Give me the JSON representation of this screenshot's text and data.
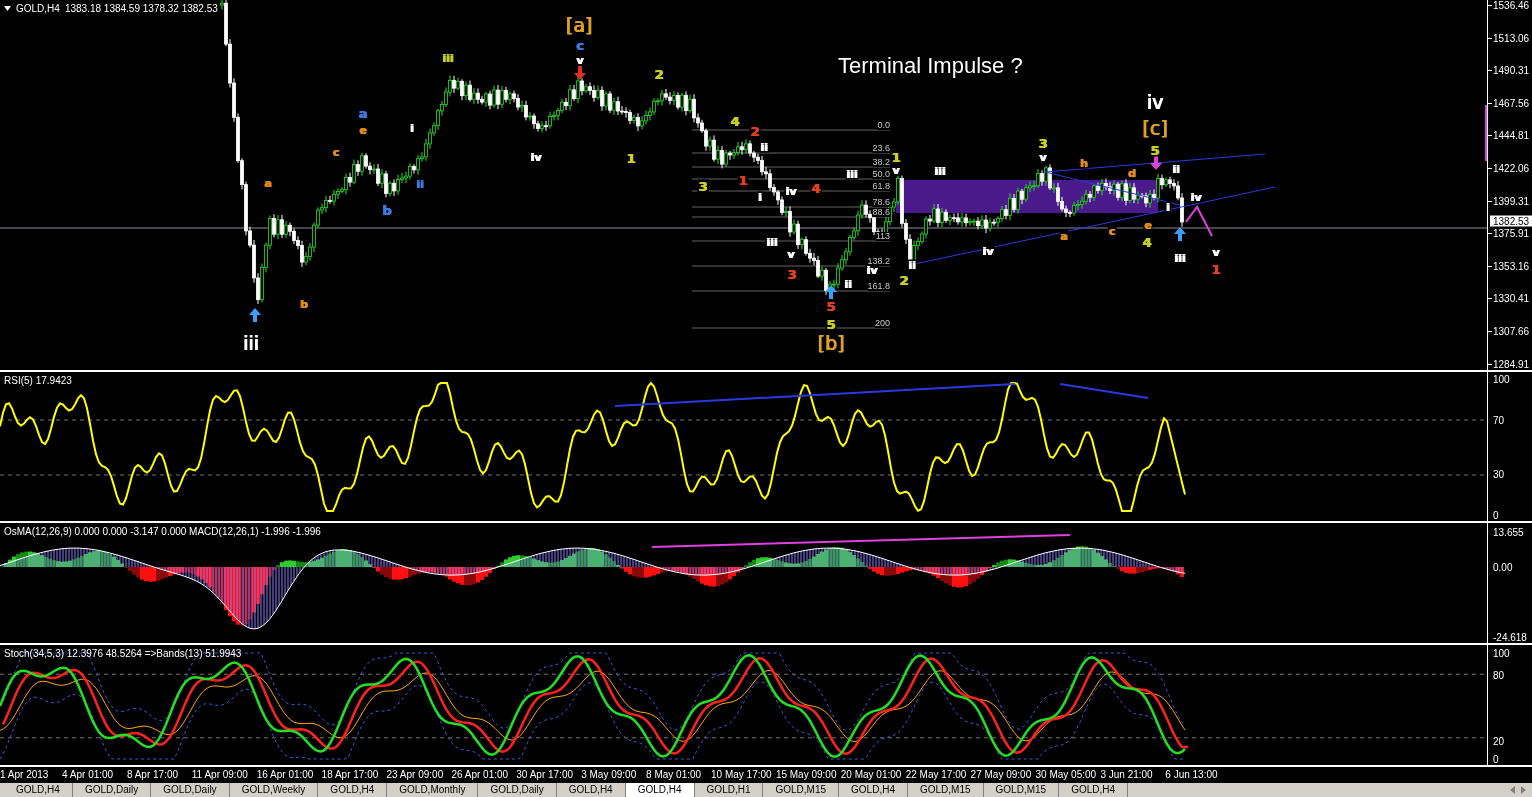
{
  "chart": {
    "symbol": "GOLD,H4",
    "ohlc": "1383.18 1384.59 1378.32 1382.53",
    "annotation": "Terminal Impulse ?",
    "price_axis": [
      "1536.46",
      "1513.06",
      "1490.31",
      "1467.56",
      "1444.81",
      "1422.06",
      "1399.31",
      "1375.91",
      "1353.16",
      "1330.41",
      "1307.66",
      "1284.91"
    ],
    "current_price": "1382.53",
    "fib_levels": [
      "0.0",
      "23.6",
      "38.2",
      "50.0",
      "61.8",
      "78.6",
      "88.6",
      "113",
      "138.2",
      "161.8",
      "200"
    ],
    "wave_labels": [
      {
        "text": "iii",
        "color": "#ffffff",
        "kind": "major"
      },
      {
        "text": "a",
        "color": "#e08a20",
        "kind": "small"
      },
      {
        "text": "b",
        "color": "#e08a20",
        "kind": "small"
      },
      {
        "text": "c",
        "color": "#e08a20",
        "kind": "small"
      },
      {
        "text": "a",
        "color": "#3a7be0",
        "kind": "minor"
      },
      {
        "text": "e",
        "color": "#e08a20",
        "kind": "small"
      },
      {
        "text": "b",
        "color": "#3a7be0",
        "kind": "minor"
      },
      {
        "text": "i",
        "color": "#ffffff",
        "kind": "small"
      },
      {
        "text": "ii",
        "color": "#3a7be0",
        "kind": "small"
      },
      {
        "text": "iii",
        "color": "#c8d020",
        "kind": "small"
      },
      {
        "text": "iv",
        "color": "#ffffff",
        "kind": "small"
      },
      {
        "text": "[a]",
        "color": "#e0a020",
        "kind": "major"
      },
      {
        "text": "c",
        "color": "#3a7be0",
        "kind": "minor"
      },
      {
        "text": "v",
        "color": "#ffffff",
        "kind": "small"
      },
      {
        "text": "1",
        "color": "#c8d020",
        "kind": "minor"
      },
      {
        "text": "2",
        "color": "#c8d020",
        "kind": "minor"
      },
      {
        "text": "3",
        "color": "#c8d020",
        "kind": "minor"
      },
      {
        "text": "4",
        "color": "#c8d020",
        "kind": "minor"
      },
      {
        "text": "1",
        "color": "#e04020",
        "kind": "minor"
      },
      {
        "text": "2",
        "color": "#e04020",
        "kind": "minor"
      },
      {
        "text": "i",
        "color": "#ffffff",
        "kind": "small"
      },
      {
        "text": "ii",
        "color": "#ffffff",
        "kind": "small"
      },
      {
        "text": "iii",
        "color": "#ffffff",
        "kind": "small"
      },
      {
        "text": "iv",
        "color": "#ffffff",
        "kind": "small"
      },
      {
        "text": "v",
        "color": "#ffffff",
        "kind": "small"
      },
      {
        "text": "3",
        "color": "#e04020",
        "kind": "minor"
      },
      {
        "text": "4",
        "color": "#e04020",
        "kind": "minor"
      },
      {
        "text": "5",
        "color": "#e04020",
        "kind": "minor"
      },
      {
        "text": "5",
        "color": "#c8d020",
        "kind": "minor"
      },
      {
        "text": "[b]",
        "color": "#e0a020",
        "kind": "major"
      },
      {
        "text": "ii",
        "color": "#ffffff",
        "kind": "small"
      },
      {
        "text": "iii",
        "color": "#ffffff",
        "kind": "small"
      },
      {
        "text": "iv",
        "color": "#ffffff",
        "kind": "small"
      },
      {
        "text": "1",
        "color": "#c8d020",
        "kind": "minor"
      },
      {
        "text": "v",
        "color": "#ffffff",
        "kind": "small"
      },
      {
        "text": "2",
        "color": "#c8d020",
        "kind": "minor"
      },
      {
        "text": "ii",
        "color": "#ffffff",
        "kind": "small"
      },
      {
        "text": "iii",
        "color": "#ffffff",
        "kind": "small"
      },
      {
        "text": "iv",
        "color": "#ffffff",
        "kind": "small"
      },
      {
        "text": "3",
        "color": "#c8d020",
        "kind": "minor"
      },
      {
        "text": "v",
        "color": "#ffffff",
        "kind": "small"
      },
      {
        "text": "a",
        "color": "#e08a20",
        "kind": "small"
      },
      {
        "text": "h",
        "color": "#e08a20",
        "kind": "small"
      },
      {
        "text": "c",
        "color": "#e08a20",
        "kind": "small"
      },
      {
        "text": "d",
        "color": "#e08a20",
        "kind": "small"
      },
      {
        "text": "e",
        "color": "#e08a20",
        "kind": "small"
      },
      {
        "text": "4",
        "color": "#c8d020",
        "kind": "minor"
      },
      {
        "text": "iv",
        "color": "#ffffff",
        "kind": "major"
      },
      {
        "text": "[c]",
        "color": "#e0a020",
        "kind": "major"
      },
      {
        "text": "5",
        "color": "#c8d020",
        "kind": "minor"
      },
      {
        "text": "i",
        "color": "#ffffff",
        "kind": "small"
      },
      {
        "text": "ii",
        "color": "#ffffff",
        "kind": "small"
      },
      {
        "text": "iii",
        "color": "#ffffff",
        "kind": "small"
      },
      {
        "text": "iv",
        "color": "#ffffff",
        "kind": "small"
      },
      {
        "text": "v",
        "color": "#ffffff",
        "kind": "small"
      },
      {
        "text": "1",
        "color": "#e04020",
        "kind": "minor"
      }
    ]
  },
  "rsi": {
    "header": "RSI(5) 17.9423",
    "axis": [
      "100",
      "70",
      "30",
      "0"
    ]
  },
  "osma": {
    "header": "OsMA(12,26,9) 0.000 0.000 -3.147 0.000  MACD(12,26,1) -1.996 -1.996",
    "axis": [
      "13.655",
      "0.00",
      "-24.618"
    ]
  },
  "stoch": {
    "header": "Stoch(34,5,3) 12.3976 48.5264  =>Bands(13) 51.9943",
    "axis": [
      "100",
      "80",
      "20",
      "0"
    ]
  },
  "time_axis": [
    "1 Apr 2013",
    "4 Apr 01:00",
    "8 Apr 17:00",
    "11 Apr 09:00",
    "16 Apr 01:00",
    "18 Apr 17:00",
    "23 Apr 09:00",
    "26 Apr 01:00",
    "30 Apr 17:00",
    "3 May 09:00",
    "8 May 01:00",
    "10 May 17:00",
    "15 May 09:00",
    "20 May 01:00",
    "22 May 17:00",
    "27 May 09:00",
    "30 May 05:00",
    "3 Jun 21:00",
    "6 Jun 13:00"
  ],
  "tabs": [
    {
      "label": "GOLD,H4",
      "selected": false
    },
    {
      "label": "GOLD,Daily",
      "selected": false
    },
    {
      "label": "GOLD,Daily",
      "selected": false
    },
    {
      "label": "GOLD,Weekly",
      "selected": false
    },
    {
      "label": "GOLD,H4",
      "selected": false
    },
    {
      "label": "GOLD,Monthly",
      "selected": false
    },
    {
      "label": "GOLD,Daily",
      "selected": false
    },
    {
      "label": "GOLD,H4",
      "selected": false
    },
    {
      "label": "GOLD,H4",
      "selected": true
    },
    {
      "label": "GOLD,H1",
      "selected": false
    },
    {
      "label": "GOLD,M15",
      "selected": false
    },
    {
      "label": "GOLD,H4",
      "selected": false
    },
    {
      "label": "GOLD,M15",
      "selected": false
    },
    {
      "label": "GOLD,M15",
      "selected": false
    },
    {
      "label": "GOLD,H4",
      "selected": false
    }
  ]
}
